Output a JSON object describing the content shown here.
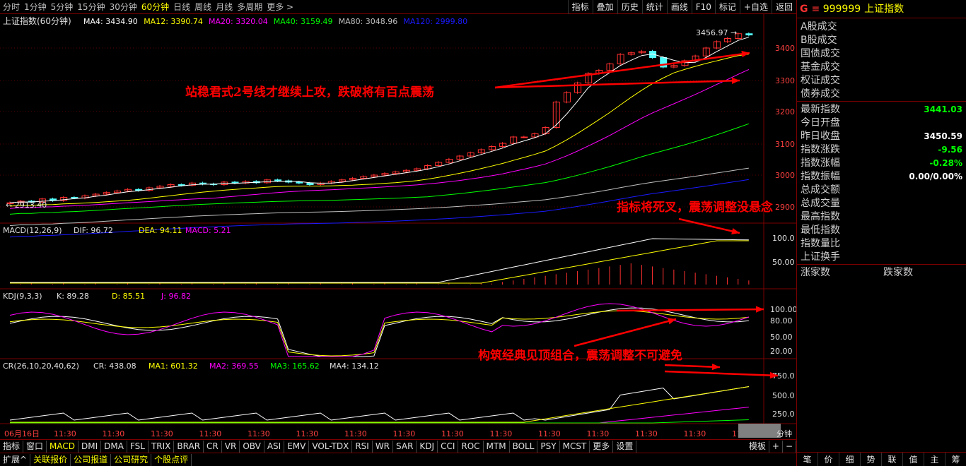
{
  "periods": [
    "分时",
    "1分钟",
    "5分钟",
    "15分钟",
    "30分钟",
    "60分钟",
    "日线",
    "周线",
    "月线",
    "多周期",
    "更多 >"
  ],
  "active_period": "60分钟",
  "tools": [
    "指标",
    "叠加",
    "历史",
    "统计",
    "画线",
    "F10",
    "标记",
    "+自选",
    "返回"
  ],
  "security": {
    "title": "上证指数(60分钟)",
    "code": "999999",
    "name": "上证指数",
    "icon": "G"
  },
  "ma_legend": [
    {
      "label": "MA4: 3434.90",
      "color": "#ffffff"
    },
    {
      "label": "MA12: 3390.74",
      "color": "#ffff00"
    },
    {
      "label": "MA20: 3320.04",
      "color": "#ff00ff"
    },
    {
      "label": "MA40: 3159.49",
      "color": "#00ff00"
    },
    {
      "label": "MA80: 3048.96",
      "color": "#c0c0c0"
    },
    {
      "label": "MA120: 2999.80",
      "color": "#1a1aff"
    }
  ],
  "price_axis": [
    "3400",
    "3300",
    "3200",
    "3100",
    "3000",
    "2900"
  ],
  "price_high_label": "3456.97",
  "price_low_label": "2913.40",
  "macd": {
    "title": "MACD(12,26,9)",
    "dif": "DIF: 96.72",
    "dea": "DEA: 94.11",
    "macd": "MACD: 5.21",
    "axis": [
      "100.0",
      "50.00"
    ]
  },
  "kdj": {
    "title": "KDJ(9,3,3)",
    "k": "K: 89.28",
    "d": "D: 85.51",
    "j": "J: 96.82",
    "axis": [
      "100.00",
      "80.00",
      "50.00",
      "20.00"
    ]
  },
  "cr": {
    "title": "CR(26,10,20,40,62)",
    "cr": "CR: 438.08",
    "ma1": "MA1: 601.32",
    "ma2": "MA2: 369.55",
    "ma3": "MA3: 165.62",
    "ma4": "MA4: 134.12",
    "axis": [
      "750.0",
      "500.0",
      "250.0"
    ]
  },
  "time_axis": {
    "date": "06月16日",
    "ticks": [
      "11:30",
      "11:30",
      "11:30",
      "11:30",
      "11:30",
      "11:30",
      "11:30",
      "11:30",
      "11:30",
      "11:30",
      "11:30",
      "11:30",
      "11:30",
      "11:30",
      "11:30"
    ],
    "unit": "分钟"
  },
  "indicator_tabs": [
    "指标",
    "窗口",
    "MACD",
    "DMI",
    "DMA",
    "FSL",
    "TRIX",
    "BRAR",
    "CR",
    "VR",
    "OBV",
    "ASI",
    "EMV",
    "VOL-TDX",
    "RSI",
    "WR",
    "SAR",
    "KDJ",
    "CCI",
    "ROC",
    "MTM",
    "BOLL",
    "PSY",
    "MCST",
    "更多",
    "设置"
  ],
  "active_tab": "MACD",
  "template_btn": "模板",
  "bottom_links": [
    "扩展^",
    "关联报价",
    "公司报道",
    "公司研究",
    "个股点评"
  ],
  "right_panel": {
    "trade_types": [
      "A股成交",
      "B股成交",
      "国债成交",
      "基金成交",
      "权证成交",
      "债券成交"
    ],
    "stats": [
      {
        "label": "最新指数",
        "value": "3441.03",
        "color": "#00ff00"
      },
      {
        "label": "今日开盘",
        "value": "",
        "color": "#ffffff"
      },
      {
        "label": "昨日收盘",
        "value": "3450.59",
        "color": "#ffffff"
      },
      {
        "label": "指数涨跌",
        "value": "-9.56",
        "color": "#00ff00"
      },
      {
        "label": "指数涨幅",
        "value": "-0.28%",
        "color": "#00ff00"
      },
      {
        "label": "指数振幅",
        "value": "0.00/0.00%",
        "color": "#ffffff"
      },
      {
        "label": "总成交额",
        "value": "",
        "color": "#ffffff"
      },
      {
        "label": "总成交量",
        "value": "",
        "color": "#ffffff"
      },
      {
        "label": "最高指数",
        "value": "",
        "color": "#ffffff"
      },
      {
        "label": "最低指数",
        "value": "",
        "color": "#ffffff"
      },
      {
        "label": "指数量比",
        "value": "",
        "color": "#ffffff"
      },
      {
        "label": "上证换手",
        "value": "",
        "color": "#ffffff"
      }
    ],
    "up_label": "涨家数",
    "down_label": "跌家数",
    "bottom_tabs": [
      "笔",
      "价",
      "细",
      "势",
      "联",
      "值",
      "主",
      "筹"
    ]
  },
  "annotations": [
    "站稳君式2号线才继续上攻，跌破将有百点震荡",
    "指标将死叉，震荡调整没悬念",
    "构筑经典见顶组合，震荡调整不可避免"
  ],
  "chart_data": {
    "type": "candlestick",
    "price_range": [
      2900,
      3460
    ],
    "closes": [
      2913,
      2918,
      2915,
      2925,
      2920,
      2930,
      2928,
      2935,
      2940,
      2945,
      2950,
      2955,
      2952,
      2960,
      2965,
      2970,
      2968,
      2975,
      2972,
      2970,
      2978,
      2975,
      2980,
      2976,
      2985,
      2982,
      2978,
      2975,
      2970,
      2975,
      2980,
      2985,
      2990,
      2995,
      3000,
      3005,
      3010,
      3015,
      3020,
      3030,
      3040,
      3050,
      3060,
      3070,
      3080,
      3090,
      3100,
      3120,
      3120,
      3130,
      3150,
      3230,
      3260,
      3290,
      3320,
      3330,
      3350,
      3380,
      3385,
      3390,
      3370,
      3340,
      3345,
      3360,
      3375,
      3400,
      3420,
      3430,
      3445,
      3441
    ],
    "macd_dif_end": 96.72,
    "kdj": {
      "k": 89.28,
      "d": 85.51,
      "j": 96.82
    },
    "cr": {
      "cr": 438.08,
      "ma1": 601.32,
      "ma2": 369.55,
      "ma3": 165.62,
      "ma4": 134.12
    }
  }
}
